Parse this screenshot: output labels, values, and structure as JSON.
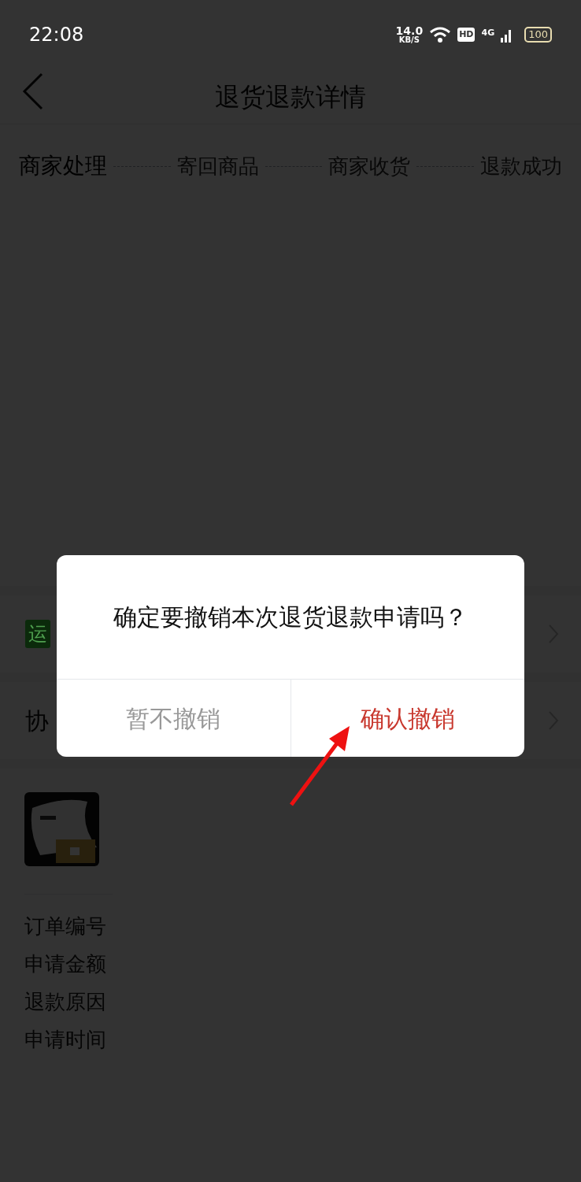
{
  "status_bar": {
    "time": "22:08",
    "speed": "14.0",
    "speed_unit": "KB/S",
    "hd": "HD",
    "network": "4G",
    "battery": "100"
  },
  "header": {
    "title": "退货退款详情"
  },
  "steps": [
    {
      "label": "商家处理",
      "selected": true
    },
    {
      "label": "寄回商品",
      "selected": false
    },
    {
      "label": "商家收货",
      "selected": false
    },
    {
      "label": "退款成功",
      "selected": false
    }
  ],
  "rows": [
    {
      "kind": "tag",
      "text": "运"
    },
    {
      "kind": "plain",
      "text": "协"
    }
  ],
  "info_labels": [
    "订单编号",
    "申请金额",
    "退款原因",
    "申请时间"
  ],
  "dialog": {
    "message": "确定要撤销本次退货退款申请吗？",
    "buttons": [
      {
        "label": "暂不撤销",
        "kind": "cancel"
      },
      {
        "label": "确认撤销",
        "kind": "confirm"
      }
    ]
  }
}
